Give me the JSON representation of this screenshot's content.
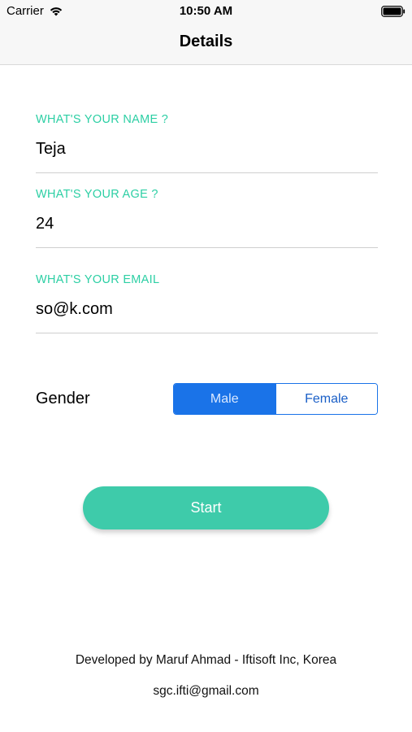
{
  "status_bar": {
    "carrier": "Carrier",
    "time": "10:50 AM"
  },
  "nav": {
    "title": "Details"
  },
  "form": {
    "name": {
      "label": "WHAT'S YOUR NAME ?",
      "value": "Teja"
    },
    "age": {
      "label": "WHAT'S YOUR AGE ?",
      "value": "24"
    },
    "email": {
      "label": "WHAT'S YOUR EMAIL",
      "value": "so@k.com"
    }
  },
  "gender": {
    "label": "Gender",
    "options": [
      "Male",
      "Female"
    ],
    "selected": "Male"
  },
  "start_button": {
    "label": "Start"
  },
  "footer": {
    "developer": "Developed by Maruf Ahmad - Iftisoft Inc, Korea",
    "email": "sgc.ifti@gmail.com"
  },
  "colors": {
    "accent_label": "#2ccfa4",
    "start_button": "#3ecbaa",
    "segment_selected": "#1a73e8"
  }
}
